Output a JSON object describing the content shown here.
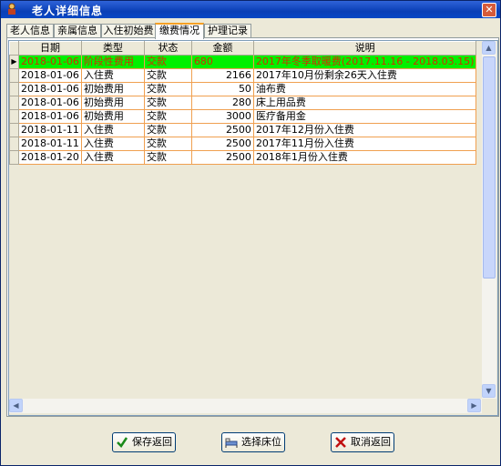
{
  "window": {
    "title": "老人详细信息",
    "close_glyph": "✕"
  },
  "tabs": [
    {
      "label": "老人信息"
    },
    {
      "label": "亲属信息"
    },
    {
      "label": "入住初始费"
    },
    {
      "label": "缴费情况",
      "active": true
    },
    {
      "label": "护理记录"
    }
  ],
  "table": {
    "columns": [
      "日期",
      "类型",
      "状态",
      "金额",
      "说明"
    ],
    "rows": [
      {
        "date": "2018-01-06",
        "type": "阶段性费用",
        "status": "交款",
        "amount": "680",
        "note": "2017年冬季取暖费(2017.11.16 - 2018.03.15)",
        "selected": true
      },
      {
        "date": "2018-01-06",
        "type": "入住费",
        "status": "交款",
        "amount": "2166",
        "note": "2017年10月份剩余26天入住费"
      },
      {
        "date": "2018-01-06",
        "type": "初始费用",
        "status": "交款",
        "amount": "50",
        "note": "油布费"
      },
      {
        "date": "2018-01-06",
        "type": "初始费用",
        "status": "交款",
        "amount": "280",
        "note": "床上用品费"
      },
      {
        "date": "2018-01-06",
        "type": "初始费用",
        "status": "交款",
        "amount": "3000",
        "note": "医疗备用金"
      },
      {
        "date": "2018-01-11",
        "type": "入住费",
        "status": "交款",
        "amount": "2500",
        "note": "2017年12月份入住费"
      },
      {
        "date": "2018-01-11",
        "type": "入住费",
        "status": "交款",
        "amount": "2500",
        "note": "2017年11月份入住费"
      },
      {
        "date": "2018-01-20",
        "type": "入住费",
        "status": "交款",
        "amount": "2500",
        "note": "2018年1月份入住费"
      }
    ],
    "row_indicator": "▶"
  },
  "buttons": {
    "save": "保存返回",
    "select_bed": "选择床位",
    "cancel": "取消返回"
  },
  "colors": {
    "selected_row": "#00f000",
    "selected_text": "#d03000",
    "title_bar": "#0a3fb6"
  }
}
